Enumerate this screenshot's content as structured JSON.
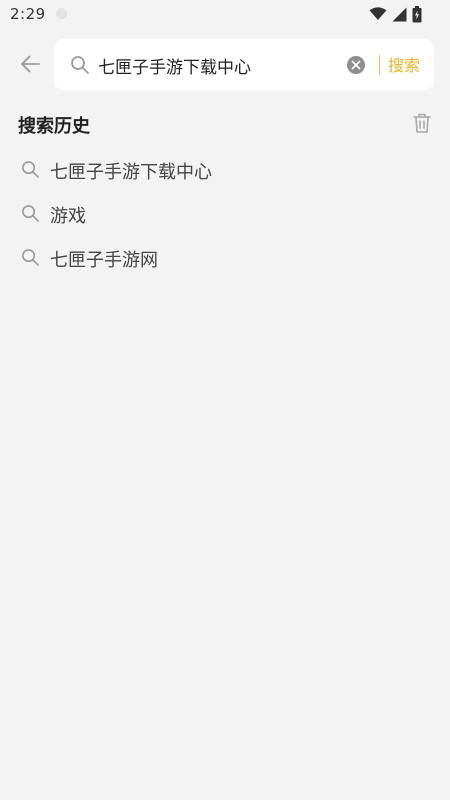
{
  "status_bar": {
    "time": "2:29"
  },
  "icons": {
    "status_dot": "circle-icon",
    "wifi": "wifi-icon",
    "signal": "signal-icon",
    "battery": "battery-icon",
    "back": "arrow-left-icon",
    "search": "search-icon",
    "clear": "clear-circle-icon",
    "trash": "trash-icon"
  },
  "colors": {
    "background": "#f3f3f3",
    "search_box": "#ffffff",
    "accent": "#e8b52c"
  },
  "search": {
    "query": "七匣子手游下载中心",
    "submit_label": "搜索"
  },
  "history": {
    "title": "搜索历史",
    "items": [
      {
        "label": "七匣子手游下载中心"
      },
      {
        "label": "游戏"
      },
      {
        "label": "七匣子手游网"
      }
    ]
  }
}
